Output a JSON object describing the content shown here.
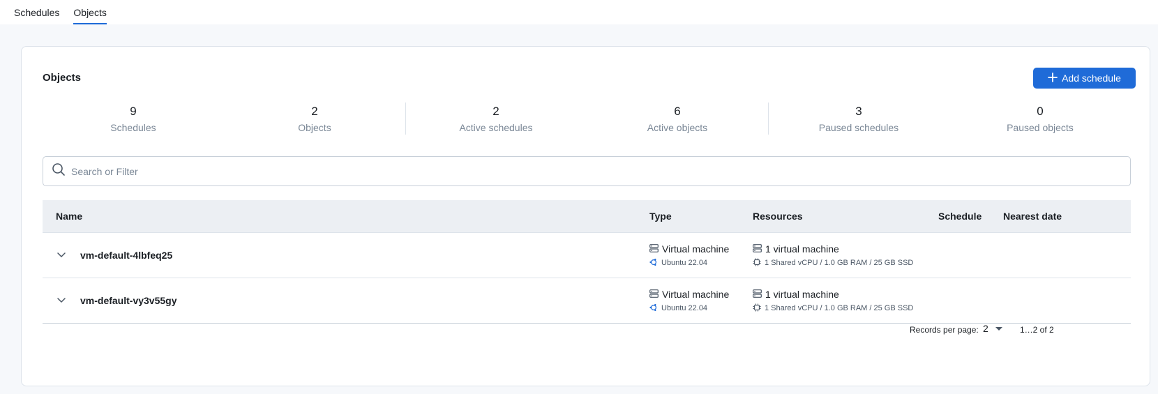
{
  "tabs": [
    {
      "label": "Schedules",
      "active": false
    },
    {
      "label": "Objects",
      "active": true
    }
  ],
  "card": {
    "title": "Objects",
    "add_button_label": "Add schedule"
  },
  "stats": [
    {
      "value": "9",
      "label": "Schedules"
    },
    {
      "value": "2",
      "label": "Objects"
    },
    {
      "value": "2",
      "label": "Active schedules"
    },
    {
      "value": "6",
      "label": "Active objects"
    },
    {
      "value": "3",
      "label": "Paused schedules"
    },
    {
      "value": "0",
      "label": "Paused objects"
    }
  ],
  "search": {
    "placeholder": "Search or Filter",
    "value": ""
  },
  "table": {
    "headers": {
      "name": "Name",
      "type": "Type",
      "resources": "Resources",
      "schedule": "Schedule",
      "nearest_date": "Nearest date"
    },
    "rows": [
      {
        "name": "vm-default-4lbfeq25",
        "type": "Virtual machine",
        "os": "Ubuntu 22.04",
        "resources": "1 virtual machine",
        "spec": "1 Shared vCPU / 1.0 GB RAM / 25 GB SSD",
        "schedule": "",
        "nearest_date": ""
      },
      {
        "name": "vm-default-vy3v55gy",
        "type": "Virtual machine",
        "os": "Ubuntu 22.04",
        "resources": "1 virtual machine",
        "spec": "1 Shared vCPU / 1.0 GB RAM / 25 GB SSD",
        "schedule": "",
        "nearest_date": ""
      }
    ]
  },
  "pagination": {
    "records_per_page_label": "Records per page:",
    "records_per_page": "2",
    "range": "1…2 of 2"
  },
  "colors": {
    "accent": "#1f6bd8",
    "muted": "#7a8796"
  }
}
